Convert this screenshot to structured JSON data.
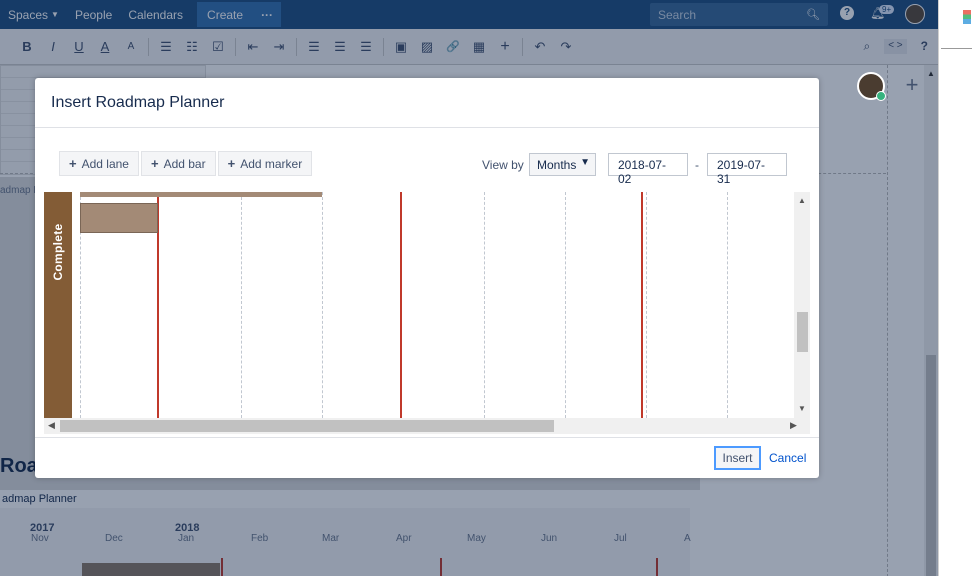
{
  "topnav": {
    "spaces": "Spaces",
    "people": "People",
    "calendars": "Calendars",
    "create": "Create",
    "more": "···",
    "search_placeholder": "Search",
    "notifications_badge": "9+"
  },
  "toolbar": {
    "bold": "B",
    "italic": "I",
    "underline": "U",
    "text_color": "A",
    "more_format": "A",
    "bullets": "☰",
    "numbers": "☷",
    "task": "☑",
    "outdent": "⇤",
    "indent": "⇥",
    "align_left": "☰",
    "align_center": "☰",
    "align_right": "☰",
    "layout": "▣",
    "image": "▨",
    "link": "🔗",
    "table": "▦",
    "insert": "+",
    "undo": "↶",
    "redo": "↷",
    "find": "⌕",
    "source": "< >",
    "help": "?"
  },
  "dialog": {
    "title": "Insert Roadmap Planner",
    "add_lane": "Add lane",
    "add_bar": "Add bar",
    "add_marker": "Add marker",
    "view_by_label": "View by",
    "view_by_value": "Months",
    "start_date": "2018-07-02",
    "date_separator": "-",
    "end_date": "2019-07-31",
    "lane_label": "Complete",
    "insert": "Insert",
    "cancel": "Cancel"
  },
  "background": {
    "title_fragment": "Roac",
    "subtitle": "admap Planner",
    "side_fragment": "admap P",
    "years": [
      {
        "label": "2017"
      },
      {
        "label": "2018"
      }
    ],
    "months": [
      "Nov",
      "Dec",
      "Jan",
      "Feb",
      "Mar",
      "Apr",
      "May",
      "Jun",
      "Jul",
      "A"
    ]
  },
  "colors": {
    "nav": "#205081",
    "lane": "#835c36",
    "bar": "#a38a76",
    "marker": "#c0392b",
    "link": "#0052cc"
  }
}
